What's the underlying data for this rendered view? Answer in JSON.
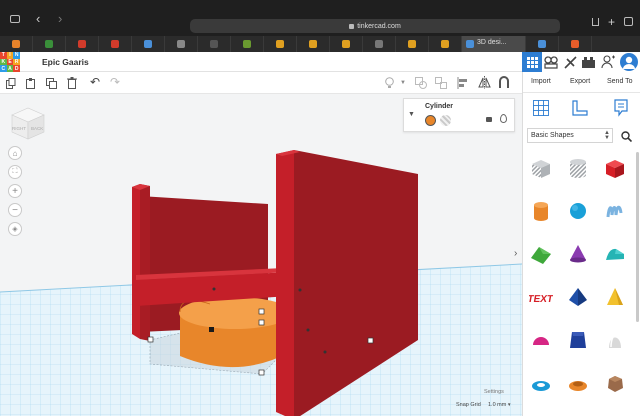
{
  "browser": {
    "url": "tinkercad.com",
    "active_tab_title": "3D desi..."
  },
  "tabs": {
    "favicon_colors": [
      "#e8832a",
      "#3a8f3a",
      "#d23b2b",
      "#d23b2b",
      "#4a90d9",
      "#888",
      "#555",
      "#6a9a30",
      "#e0a020",
      "#e0a020",
      "#e0a020",
      "#777",
      "#e0a020",
      "#e0a020",
      "#4a90d9",
      "#e85d2a"
    ]
  },
  "app": {
    "logo_letters": [
      "T",
      "I",
      "N",
      "K",
      "E",
      "R",
      "C",
      "A",
      "D"
    ],
    "logo_colors": [
      "#e8462d",
      "#f4a623",
      "#2d9ce8",
      "#5fb846",
      "#e8462d",
      "#f4a623",
      "#2d9ce8",
      "#5fb846",
      "#e8462d"
    ],
    "project_name": "Epic Gaaris"
  },
  "viewcube": {
    "left_face": "RIGHT",
    "front_face": "BACK"
  },
  "inspector": {
    "title": "Cylinder",
    "solid_color": "#e8862a",
    "hole_color": "#c9c9c9"
  },
  "right_panel": {
    "tabs": [
      "Import",
      "Export",
      "Send To"
    ],
    "shape_category": "Basic Shapes",
    "accent": "#2d7dd2"
  },
  "shapes": [
    {
      "name": "box-hole",
      "color": "#b9bcc0"
    },
    {
      "name": "cylinder-hole",
      "color": "#b9bcc0"
    },
    {
      "name": "box",
      "color": "#d61e26"
    },
    {
      "name": "cylinder",
      "color": "#e8862a"
    },
    {
      "name": "sphere",
      "color": "#19a0d8"
    },
    {
      "name": "scribble",
      "color": "#7bb3e0"
    },
    {
      "name": "roof",
      "color": "#3fa83b"
    },
    {
      "name": "cone",
      "color": "#8a3bb0"
    },
    {
      "name": "round-roof",
      "color": "#25b4b4"
    },
    {
      "name": "text",
      "color": "#d61e26"
    },
    {
      "name": "pyramid",
      "color": "#1f4fa8"
    },
    {
      "name": "wedge",
      "color": "#f2c12e"
    },
    {
      "name": "half-sphere",
      "color": "#d62684"
    },
    {
      "name": "polygon",
      "color": "#1f3f9a"
    },
    {
      "name": "paraboloid",
      "color": "#d9d9d9"
    },
    {
      "name": "torus",
      "color": "#1a9ad6"
    },
    {
      "name": "tube",
      "color": "#e8862a"
    },
    {
      "name": "icosahedron",
      "color": "#9a6a4a"
    }
  ],
  "viewport": {
    "settings_label": "Settings",
    "snap_grid_label": "Snap Grid",
    "snap_grid_value": "1.0 mm"
  }
}
